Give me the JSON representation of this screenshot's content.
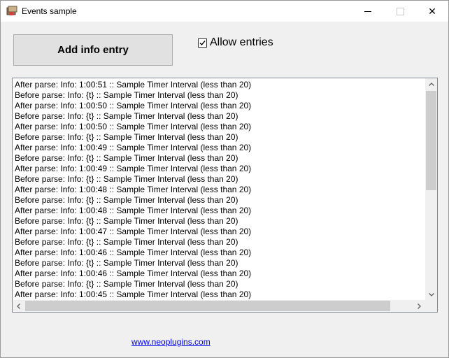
{
  "window": {
    "title": "Events sample",
    "minimize_label": "",
    "maximize_label": "",
    "close_label": "✕"
  },
  "toolbar": {
    "add_button_label": "Add info entry",
    "allow_entries_label": "Allow entries",
    "allow_entries_checked": true
  },
  "log": {
    "rows": [
      "After parse: Info: 1:00:51 :: Sample Timer Interval (less than 20)",
      "Before parse: Info: {t} :: Sample Timer Interval (less than 20)",
      "After parse: Info: 1:00:50 :: Sample Timer Interval (less than 20)",
      "Before parse: Info: {t} :: Sample Timer Interval (less than 20)",
      "After parse: Info: 1:00:50 :: Sample Timer Interval (less than 20)",
      "Before parse: Info: {t} :: Sample Timer Interval (less than 20)",
      "After parse: Info: 1:00:49 :: Sample Timer Interval (less than 20)",
      "Before parse: Info: {t} :: Sample Timer Interval (less than 20)",
      "After parse: Info: 1:00:49 :: Sample Timer Interval (less than 20)",
      "Before parse: Info: {t} :: Sample Timer Interval (less than 20)",
      "After parse: Info: 1:00:48 :: Sample Timer Interval (less than 20)",
      "Before parse: Info: {t} :: Sample Timer Interval (less than 20)",
      "After parse: Info: 1:00:48 :: Sample Timer Interval (less than 20)",
      "Before parse: Info: {t} :: Sample Timer Interval (less than 20)",
      "After parse: Info: 1:00:47 :: Sample Timer Interval (less than 20)",
      "Before parse: Info: {t} :: Sample Timer Interval (less than 20)",
      "After parse: Info: 1:00:46 :: Sample Timer Interval (less than 20)",
      "Before parse: Info: {t} :: Sample Timer Interval (less than 20)",
      "After parse: Info: 1:00:46 :: Sample Timer Interval (less than 20)",
      "Before parse: Info: {t} :: Sample Timer Interval (less than 20)",
      "After parse: Info: 1:00:45 :: Sample Timer Interval (less than 20)"
    ]
  },
  "footer": {
    "link_text": "www.neoplugins.com"
  },
  "icons": {
    "app": "app-icon",
    "check": "checkmark-icon",
    "up": "arrow-up-icon",
    "down": "arrow-down-icon",
    "left": "arrow-left-icon",
    "right": "arrow-right-icon"
  },
  "colors": {
    "link": "#0000ee",
    "button_bg": "#e1e1e1",
    "window_bg": "#f0f0f0"
  }
}
